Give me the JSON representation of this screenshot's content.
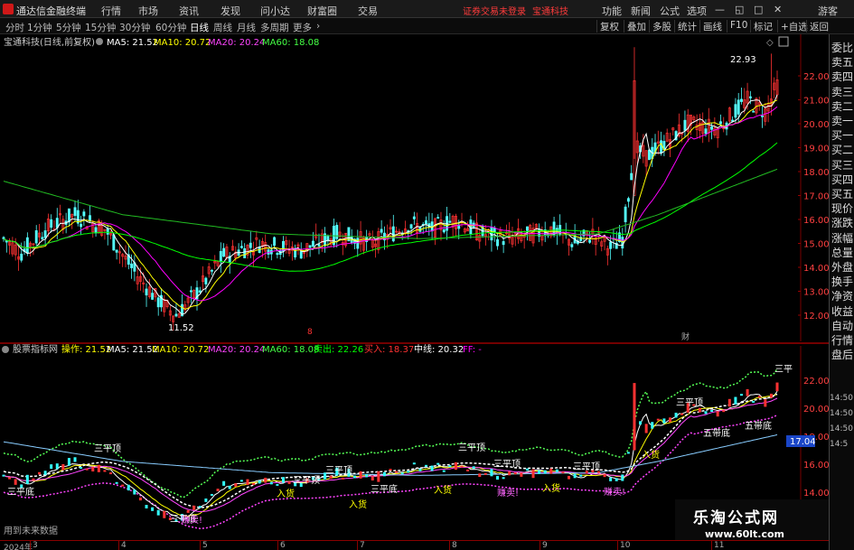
{
  "app": {
    "title": "通达信金融终端"
  },
  "menu": [
    "行情",
    "市场",
    "资讯",
    "发现",
    "问小达",
    "财富圈",
    "交易"
  ],
  "notice": "证券交易未登录",
  "stock_top": "宝通科技",
  "right_menu": [
    "功能",
    "新闻",
    "公式",
    "选项"
  ],
  "guest": "游客",
  "periods": [
    "分时",
    "1分钟",
    "5分钟",
    "15分钟",
    "30分钟",
    "60分钟",
    "日线",
    "周线",
    "月线",
    "多周期",
    "更多"
  ],
  "active_period": "日线",
  "tools": [
    "复权",
    "叠加",
    "多股",
    "统计",
    "画线",
    "F10",
    "标记",
    "+自选",
    "返回"
  ],
  "main": {
    "stock": "宝通科技(日线,前复权)",
    "ma5": "MA5: 21.52",
    "ma10": "MA10: 20.72",
    "ma20": "MA20: 20.24",
    "ma60": "MA60: 18.08",
    "high": "22.93",
    "low": "11.52",
    "prices": [
      "22.00",
      "21.00",
      "20.00",
      "19.00",
      "18.00",
      "17.00",
      "16.00",
      "15.00",
      "14.00",
      "13.00",
      "12.00"
    ],
    "flag": "财"
  },
  "sub": {
    "name": "股票指标网",
    "cao": "操作: 21.52",
    "ma5": "MA5: 21.52",
    "ma10": "MA10: 20.72",
    "ma20": "MA20: 20.24",
    "ma60": "MA60: 18.08",
    "sell": "卖出: 22.26",
    "buy": "买入: 18.37",
    "mid": "中线: 20.32",
    "ff": "FF: -",
    "prices": [
      "22.00",
      "20.00",
      "18.00",
      "16.00",
      "14.00"
    ],
    "current": "17.04",
    "footnote": "用到未来数据",
    "labels": [
      "三平顶",
      "三平顶",
      "三平底",
      "三平底",
      "三平顶",
      "三平顶",
      "三平顶",
      "三平底",
      "三平顶",
      "三平顶",
      "五带底",
      "五带底",
      "入货",
      "入货",
      "入货",
      "入货",
      "入货",
      "赚卖!",
      "赚卖!",
      "赚卖!",
      "三平"
    ]
  },
  "right_panel": [
    "委比",
    "卖五",
    "卖四",
    "卖三",
    "卖二",
    "卖一",
    "买一",
    "买二",
    "买三",
    "买四",
    "买五",
    "现价",
    "涨跌",
    "涨幅",
    "总量",
    "外盘",
    "换手",
    "净资",
    "收益",
    "自动",
    "行情",
    "盘后"
  ],
  "right_prices": [
    "14:50",
    "14:50",
    "14:50",
    "14:5"
  ],
  "dates": [
    "2024年",
    "3",
    "4",
    "5",
    "6",
    "7",
    "8",
    "9",
    "10",
    "11"
  ],
  "watermark": {
    "site": "乐淘公式网",
    "url": "www.60lt.com"
  },
  "colors": {
    "up": "#ff3232",
    "down": "#54ffff",
    "ma5": "#ffffff",
    "ma10": "#ffff00",
    "ma20": "#ff00ff",
    "ma60": "#00ff00"
  }
}
